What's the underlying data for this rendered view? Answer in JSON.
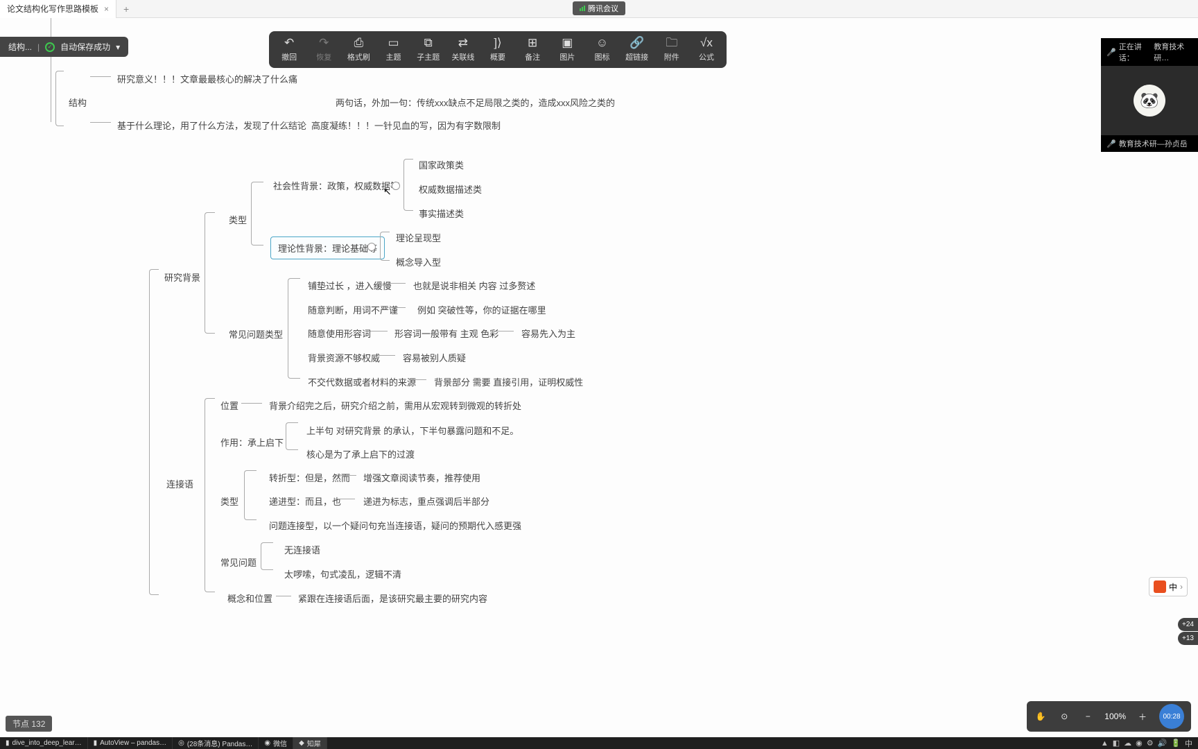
{
  "tab": {
    "title": "论文结构化写作思路模板",
    "close": "×",
    "add": "+"
  },
  "tencent_meeting": "腾讯会议",
  "title_bar": {
    "doc": "结构...",
    "autosave": "自动保存成功"
  },
  "toolbar": {
    "undo": "撤回",
    "redo": "恢复",
    "format": "格式刷",
    "topic": "主题",
    "subtopic": "子主题",
    "relation": "关联线",
    "summary": "概要",
    "note": "备注",
    "image": "图片",
    "icon": "图标",
    "link": "超链接",
    "attach": "附件",
    "formula": "公式"
  },
  "icons": {
    "undo": "↶",
    "redo": "↷",
    "format": "⎙",
    "topic": "▭",
    "subtopic": "⧉",
    "relation": "⇄",
    "summary": "]⟩",
    "note": "⊞",
    "image": "▣",
    "icon": "☺",
    "link": "🔗",
    "attach": "🗀",
    "formula": "√x"
  },
  "nodes": {
    "structure": "结构",
    "significance": "研究意义！！！文章最最核心的解决了什么痛",
    "method": "基于什么理论，用了什么方法，发现了什么结论",
    "refine": "高度凝练！！！一针见血的写，因为有字数限制",
    "two_sentences": "两句话，外加一句：传统xxx缺点不足局限之类的，造成xxx风险之类的",
    "background": "研究背景",
    "type": "类型",
    "social_bg": "社会性背景：政策，权威数据等",
    "policy": "国家政策类",
    "auth_data": "权威数据描述类",
    "fact_desc": "事实描述类",
    "theory_bg": "理论性背景：理论基础等",
    "theory_present": "理论呈现型",
    "concept_intro": "概念导入型",
    "common_problems": "常见问题类型",
    "p1": "铺垫过长 ，进入缓慢",
    "p1d": "也就是说非相关 内容 过多赘述",
    "p2": "随意判断，用词不严谨",
    "p2d": "例如 突破性等，你的证据在哪里",
    "p3": "随意使用形容词",
    "p3d": "形容词一般带有 主观 色彩",
    "p3d2": "容易先入为主",
    "p4": "背景资源不够权威",
    "p4d": "容易被别人质疑",
    "p5": "不交代数据或者材料的来源",
    "p5d": "背景部分 需要 直接引用，证明权威性",
    "connector": "连接语",
    "position": "位置",
    "position_d": "背景介绍完之后，研究介绍之前，需用从宏观转到微观的转折处",
    "function": "作用：承上启下",
    "f1": "上半句 对研究背景 的承认，下半句暴露问题和不足。",
    "f2": "核心是为了承上启下的过渡",
    "conn_type": "类型",
    "ct1": "转折型：但是，然而",
    "ct1d": "增强文章阅读节奏，推荐使用",
    "ct2": "递进型：而且，也",
    "ct2d": "递进为标志，重点强调后半部分",
    "ct3": "问题连接型，以一个疑问句充当连接语，疑问的预期代入感更强",
    "conn_problems": "常见问题",
    "cp1": "无连接语",
    "cp2": "太啰嗦，句式凌乱，逻辑不清",
    "concept_pos": "概念和位置",
    "concept_pos_d": "紧跟在连接语后面，是该研究最主要的研究内容"
  },
  "meeting": {
    "speaking_prefix": "正在讲话：",
    "speaking_name": "教育技术研…",
    "footer": "教育技术研—孙贞岳"
  },
  "status": {
    "node_count_label": "节点",
    "node_count_value": "132",
    "zoom": "100%",
    "timer": "00:28",
    "ime": "中"
  },
  "side_pills": {
    "a": "+24",
    "b": "+13"
  },
  "taskbar": {
    "items": [
      "dive_into_deep_lear…",
      "AutoView – pandas…",
      "(28条消息) Pandas…",
      "微信",
      "知犀"
    ],
    "active_index": 4
  },
  "chart_data": {
    "type": "tree",
    "summary": "Mind map: 论文结构化写作思路模板 → 结构 / 研究背景 / 连接语 branches with sub-nodes as listed in nodes object"
  }
}
